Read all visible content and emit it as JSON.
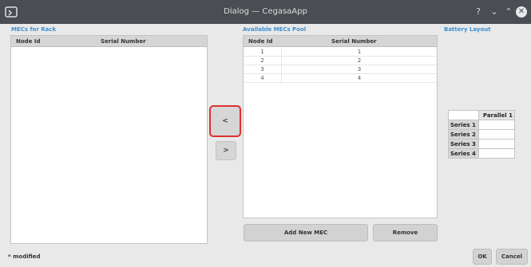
{
  "window": {
    "title": "Dialog — CegasaApp",
    "help_label": "?",
    "minimize_label": "⌄",
    "maximize_label": "⌃",
    "close_label": "✕"
  },
  "mecs_for_rack": {
    "title": "MECs for Rack",
    "columns": [
      "Node Id",
      "Serial Number"
    ]
  },
  "available_pool": {
    "title": "Available MECs Pool",
    "columns": [
      "Node Id",
      "Serial Number"
    ],
    "rows": [
      {
        "node_id": "1",
        "serial": "1"
      },
      {
        "node_id": "2",
        "serial": "2"
      },
      {
        "node_id": "3",
        "serial": "3"
      },
      {
        "node_id": "4",
        "serial": "4"
      }
    ],
    "add_button": "Add New MEC",
    "remove_button": "Remove"
  },
  "transfer": {
    "to_rack_label": "<",
    "to_pool_label": ">"
  },
  "battery_layout": {
    "title": "Battery Layout",
    "column_header": "Parallel 1",
    "rows": [
      "Series 1",
      "Series 2",
      "Series 3",
      "Series 4"
    ]
  },
  "footer": {
    "modified_label": "* modified",
    "ok_button": "OK",
    "cancel_button": "Cancel"
  },
  "colors": {
    "accent": "#3d8fd1",
    "focus_ring": "#e03030",
    "titlebar": "#4a4d52"
  }
}
